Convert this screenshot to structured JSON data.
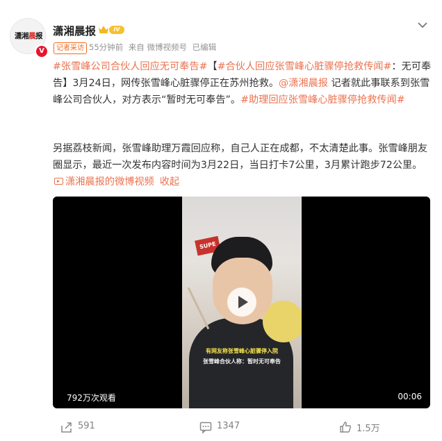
{
  "post": {
    "author": {
      "name": "潇湘晨报",
      "level": "IV",
      "verified_badge": "V",
      "avatar_logo_a": "潇湘",
      "avatar_logo_b": "晨",
      "avatar_logo_c": "报"
    },
    "tag": "记者采访",
    "meta": {
      "time": "55分钟前",
      "source": "来自 微博视频号",
      "edited": "已编辑"
    },
    "para1": {
      "hashtag1": "#张雪峰公司合伙人回应无可奉告#",
      "bracket_open": "【",
      "hashtag2": "#合伙人回应张雪峰心脏骤停抢救传闻#",
      "text1": "：无可奉告】3月24日，网传张雪峰心脏骤停正在苏州抢救。",
      "mention": "@潇湘晨报",
      "text2": " 记者就此事联系到张雪峰公司合伙人，对方表示“暂时无可奉告”。",
      "hashtag3": "#助理回应张雪峰心脏骤停抢救传闻#"
    },
    "para2": {
      "text": "另据荔枝新闻，张雪峰助理万霞回应称，自己人正在成都，不太清楚此事。张雪峰朋友圈显示，最近一次发布内容时间为3月22日，当日打卡7公里，3月累计跑步72公里。",
      "video_link": "潇湘晨报的微博视频",
      "collapse": "收起"
    }
  },
  "video": {
    "views": "792万次观看",
    "duration": "00:06",
    "sign_text": "SUPE",
    "caption_line1": "有网友称张雪峰心脏骤停入院",
    "caption_line2": "张雪峰合伙人称：暂时无可奉告"
  },
  "actions": {
    "share_count": "591",
    "comment_count": "1347",
    "like_count": "1.5万"
  },
  "colors": {
    "accent": "#eb7350",
    "verified": "#e6162d",
    "tag": "#f26b1d"
  }
}
